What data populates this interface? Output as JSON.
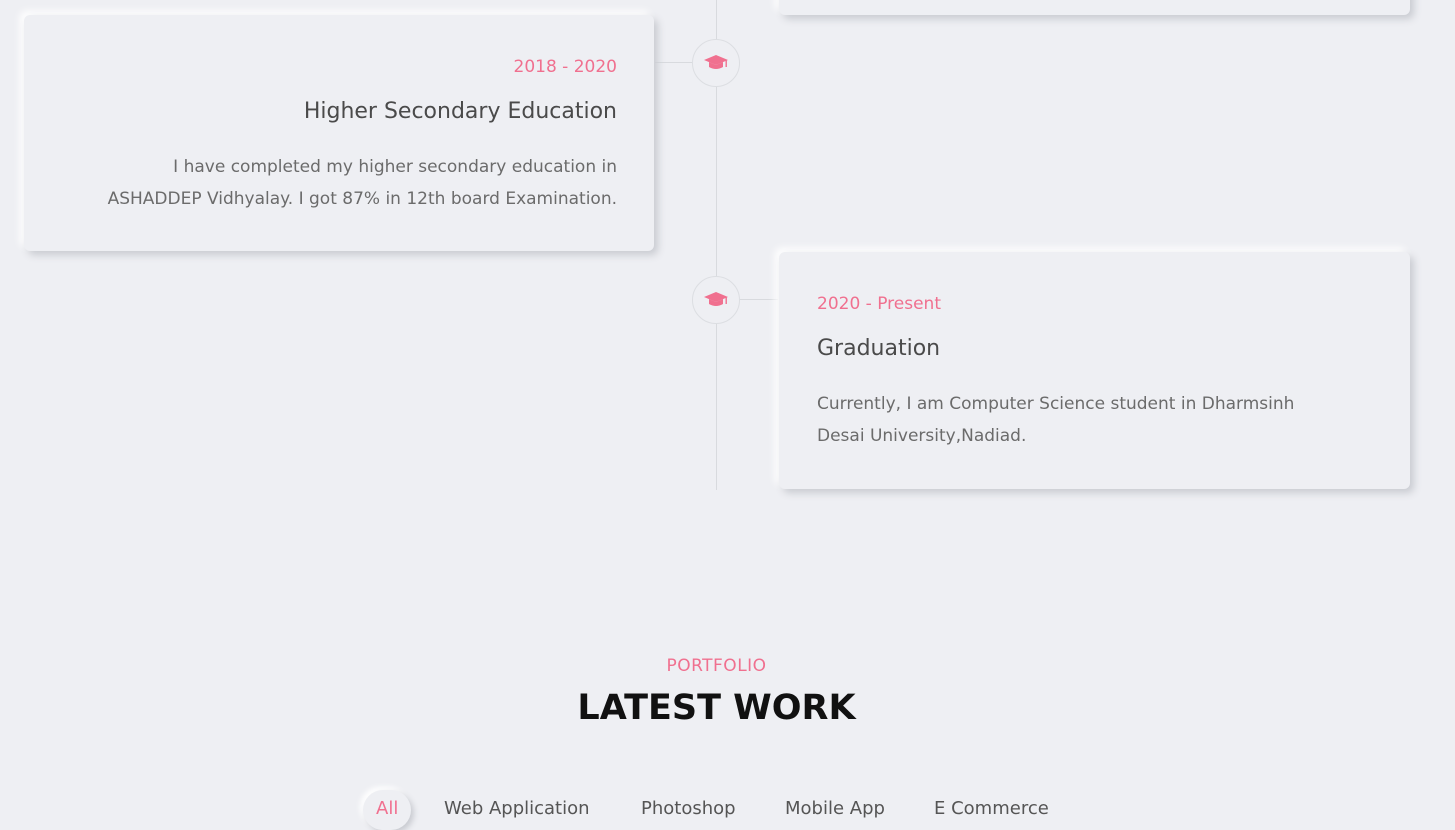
{
  "timeline": {
    "top_card_partial": {},
    "entries": [
      {
        "date": "2018 - 2020",
        "title": "Higher Secondary Education",
        "description_lines": [
          "I have completed my higher secondary education in",
          "ASHADDEP Vidhyalay. I got 87% in 12th board Examination."
        ],
        "icon": "graduation-cap-icon"
      },
      {
        "date": "2020 - Present",
        "title": "Graduation",
        "description_lines": [
          "Currently, I am Computer Science student in Dharmsinh",
          "Desai University,Nadiad."
        ],
        "icon": "graduation-cap-icon"
      }
    ]
  },
  "portfolio": {
    "subtitle": "PORTFOLIO",
    "title": "LATEST WORK",
    "filters": [
      "All",
      "Web Application",
      "Photoshop",
      "Mobile App",
      "E Commerce"
    ],
    "active_filter": "All"
  },
  "colors": {
    "accent": "#f0708f",
    "background": "#eeeff3",
    "heading": "#4a4a4a",
    "text": "#6b6b6b"
  }
}
